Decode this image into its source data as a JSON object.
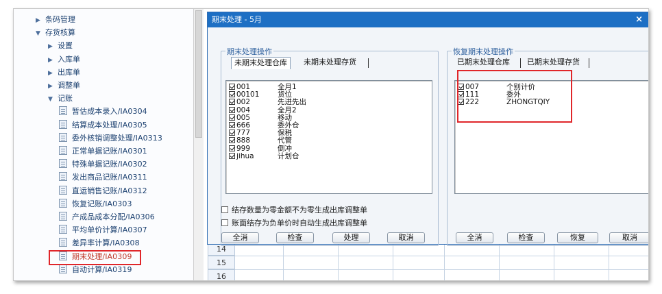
{
  "nav": {
    "items": [
      {
        "label": "条码管理",
        "kind": "folder",
        "state": "collapsed",
        "level": 0
      },
      {
        "label": "存货核算",
        "kind": "folder",
        "state": "expanded",
        "level": 0
      },
      {
        "label": "设置",
        "kind": "folder",
        "state": "collapsed",
        "level": 1
      },
      {
        "label": "入库单",
        "kind": "folder",
        "state": "collapsed",
        "level": 1
      },
      {
        "label": "出库单",
        "kind": "folder",
        "state": "collapsed",
        "level": 1
      },
      {
        "label": "调整单",
        "kind": "folder",
        "state": "collapsed",
        "level": 1
      },
      {
        "label": "记账",
        "kind": "folder",
        "state": "expanded",
        "level": 1
      },
      {
        "label": "暂估成本录入/IA0304",
        "kind": "leaf",
        "level": 2
      },
      {
        "label": "结算成本处理/IA0305",
        "kind": "leaf",
        "level": 2
      },
      {
        "label": "委外核销调整处理/IA0313",
        "kind": "leaf",
        "level": 2
      },
      {
        "label": "正常单据记账/IA0301",
        "kind": "leaf",
        "level": 2
      },
      {
        "label": "特殊单据记账/IA0302",
        "kind": "leaf",
        "level": 2
      },
      {
        "label": "发出商品记账/IA0311",
        "kind": "leaf",
        "level": 2
      },
      {
        "label": "直运销售记账/IA0312",
        "kind": "leaf",
        "level": 2
      },
      {
        "label": "恢复记账/IA0303",
        "kind": "leaf",
        "level": 2
      },
      {
        "label": "产成品成本分配/IA0306",
        "kind": "leaf",
        "level": 2
      },
      {
        "label": "平均单价计算/IA0307",
        "kind": "leaf",
        "level": 2
      },
      {
        "label": "差异率计算/IA0308",
        "kind": "leaf",
        "level": 2
      },
      {
        "label": "期末处理/IA0309",
        "kind": "leaf",
        "level": 2,
        "selected": true
      },
      {
        "label": "自动计算/IA0319",
        "kind": "leaf",
        "level": 2
      }
    ]
  },
  "grid": {
    "row_numbers": [
      "14",
      "15",
      "16"
    ]
  },
  "dialog": {
    "title": "期末处理 - 5月",
    "close_symbol": "×",
    "left_group": {
      "title": "期末处理操作",
      "tabs": [
        "未期末处理仓库",
        "未期末处理存货"
      ],
      "active_tab": 0,
      "items": [
        {
          "code": "001",
          "name": "全月1",
          "checked": true
        },
        {
          "code": "00101",
          "name": "货位",
          "checked": true
        },
        {
          "code": "002",
          "name": "先进先出",
          "checked": true
        },
        {
          "code": "004",
          "name": "全月2",
          "checked": true
        },
        {
          "code": "005",
          "name": "移动",
          "checked": true
        },
        {
          "code": "666",
          "name": "委外仓",
          "checked": true
        },
        {
          "code": "777",
          "name": "保税",
          "checked": true
        },
        {
          "code": "888",
          "name": "代管",
          "checked": true
        },
        {
          "code": "999",
          "name": "倒冲",
          "checked": true
        },
        {
          "code": "jihua",
          "name": "计划仓",
          "checked": true
        }
      ],
      "options": [
        {
          "label": "结存数量为零金额不为零生成出库调整单",
          "checked": false
        },
        {
          "label": "账面结存为负单价时自动生成出库调整单",
          "checked": false
        }
      ],
      "buttons": [
        "全消",
        "检查",
        "处理",
        "取消"
      ]
    },
    "right_group": {
      "title": "恢复期末处理操作",
      "tabs": [
        "已期末处理仓库",
        "已期末处理存货"
      ],
      "active_tab": 0,
      "items": [
        {
          "code": "007",
          "name": "个别计价",
          "checked": true
        },
        {
          "code": "111",
          "name": "委外",
          "checked": true
        },
        {
          "code": "222",
          "name": "ZHONGTQIY",
          "checked": true
        }
      ],
      "buttons": [
        "全消",
        "检查",
        "恢复",
        "取消"
      ]
    }
  },
  "colors": {
    "titlebar": "#1d6fc4",
    "highlight_red": "#e0262a",
    "nav_text": "#1a3f6f"
  }
}
